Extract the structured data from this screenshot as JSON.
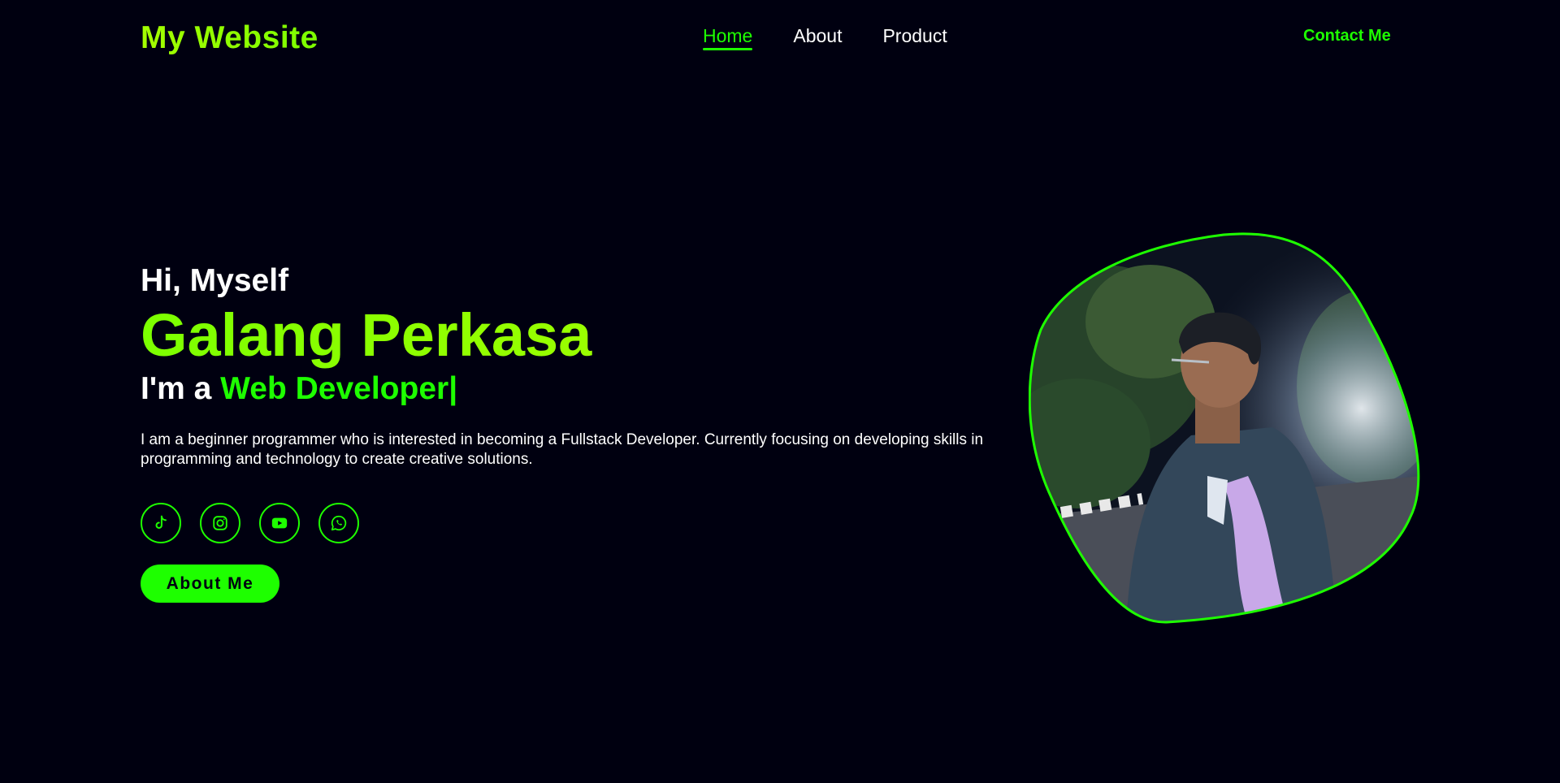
{
  "header": {
    "logo": "My Website",
    "nav": [
      {
        "label": "Home",
        "active": true
      },
      {
        "label": "About",
        "active": false
      },
      {
        "label": "Product",
        "active": false
      }
    ],
    "contact_label": "Contact Me"
  },
  "hero": {
    "greeting": "Hi, Myself",
    "name": "Galang Perkasa",
    "role_prefix": "I'm a ",
    "role_highlight": "Web Developer|",
    "description": "I am a beginner programmer who is interested in becoming a Fullstack Developer. Currently focusing on developing skills in programming and technology to create creative solutions.",
    "socials": [
      {
        "icon": "tiktok-icon"
      },
      {
        "icon": "instagram-icon"
      },
      {
        "icon": "youtube-icon"
      },
      {
        "icon": "whatsapp-icon"
      }
    ],
    "about_button": "About Me"
  },
  "colors": {
    "background": "#000010",
    "accent": "#1eff00",
    "logo_gradient_start": "#a4ff00",
    "name_gradient_start": "#7cff00",
    "name_gradient_end": "#b6ff00"
  }
}
